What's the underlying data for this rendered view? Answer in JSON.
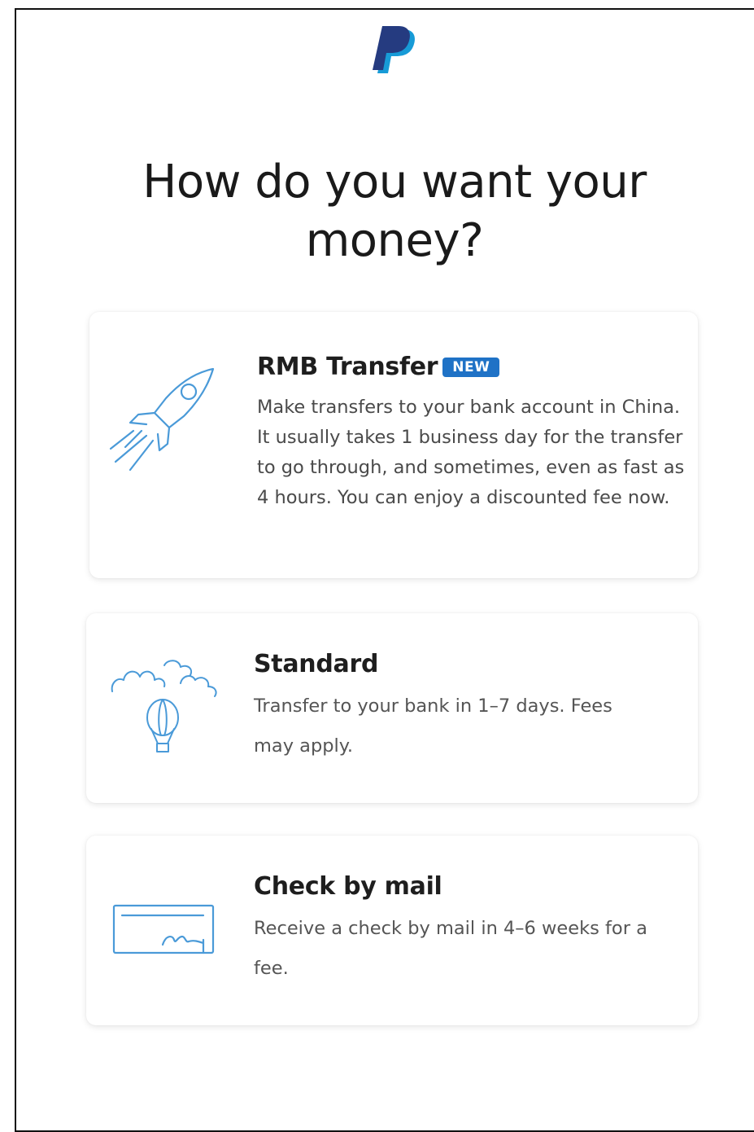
{
  "header": {
    "logo_icon": "paypal-logo-icon",
    "title": "How do you want your money?"
  },
  "colors": {
    "accent": "#1f72c6",
    "icon_stroke": "#4a9ad8",
    "logo_dark": "#253b80",
    "logo_light": "#179bd7"
  },
  "options": [
    {
      "id": "rmb-transfer",
      "icon": "rocket-icon",
      "title": "RMB Transfer",
      "badge": "NEW",
      "description": "Make transfers to your bank account in China. It usually takes 1 business day for the transfer to go through, and sometimes, even as fast as 4 hours. You can enjoy a discounted fee now."
    },
    {
      "id": "standard",
      "icon": "hot-air-balloon-icon",
      "title": "Standard",
      "description": "Transfer to your bank in 1–7 days. Fees may apply."
    },
    {
      "id": "check-by-mail",
      "icon": "check-icon",
      "title": "Check by mail",
      "description": "Receive a check by mail in 4–6 weeks for a fee."
    }
  ]
}
